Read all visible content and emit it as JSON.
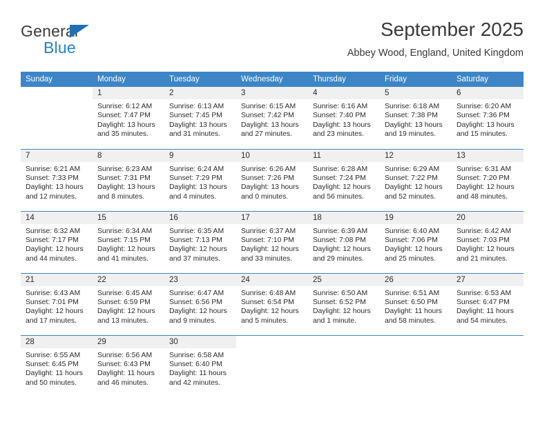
{
  "brand": {
    "name_top": "General",
    "name_bottom": "Blue",
    "accent_color": "#2083c9",
    "triangle_color": "#1f6fb5"
  },
  "header": {
    "title": "September 2025",
    "subtitle": "Abbey Wood, England, United Kingdom"
  },
  "theme": {
    "header_blue": "#3d85c6",
    "daynum_band": "#f0f0f0",
    "text": "#2b2b2b"
  },
  "weekday_headers": [
    "Sunday",
    "Monday",
    "Tuesday",
    "Wednesday",
    "Thursday",
    "Friday",
    "Saturday"
  ],
  "weeks": [
    [
      {
        "day": "",
        "sunrise": "",
        "sunset": "",
        "daylight": ""
      },
      {
        "day": "1",
        "sunrise": "Sunrise: 6:12 AM",
        "sunset": "Sunset: 7:47 PM",
        "daylight": "Daylight: 13 hours and 35 minutes."
      },
      {
        "day": "2",
        "sunrise": "Sunrise: 6:13 AM",
        "sunset": "Sunset: 7:45 PM",
        "daylight": "Daylight: 13 hours and 31 minutes."
      },
      {
        "day": "3",
        "sunrise": "Sunrise: 6:15 AM",
        "sunset": "Sunset: 7:42 PM",
        "daylight": "Daylight: 13 hours and 27 minutes."
      },
      {
        "day": "4",
        "sunrise": "Sunrise: 6:16 AM",
        "sunset": "Sunset: 7:40 PM",
        "daylight": "Daylight: 13 hours and 23 minutes."
      },
      {
        "day": "5",
        "sunrise": "Sunrise: 6:18 AM",
        "sunset": "Sunset: 7:38 PM",
        "daylight": "Daylight: 13 hours and 19 minutes."
      },
      {
        "day": "6",
        "sunrise": "Sunrise: 6:20 AM",
        "sunset": "Sunset: 7:36 PM",
        "daylight": "Daylight: 13 hours and 15 minutes."
      }
    ],
    [
      {
        "day": "7",
        "sunrise": "Sunrise: 6:21 AM",
        "sunset": "Sunset: 7:33 PM",
        "daylight": "Daylight: 13 hours and 12 minutes."
      },
      {
        "day": "8",
        "sunrise": "Sunrise: 6:23 AM",
        "sunset": "Sunset: 7:31 PM",
        "daylight": "Daylight: 13 hours and 8 minutes."
      },
      {
        "day": "9",
        "sunrise": "Sunrise: 6:24 AM",
        "sunset": "Sunset: 7:29 PM",
        "daylight": "Daylight: 13 hours and 4 minutes."
      },
      {
        "day": "10",
        "sunrise": "Sunrise: 6:26 AM",
        "sunset": "Sunset: 7:26 PM",
        "daylight": "Daylight: 13 hours and 0 minutes."
      },
      {
        "day": "11",
        "sunrise": "Sunrise: 6:28 AM",
        "sunset": "Sunset: 7:24 PM",
        "daylight": "Daylight: 12 hours and 56 minutes."
      },
      {
        "day": "12",
        "sunrise": "Sunrise: 6:29 AM",
        "sunset": "Sunset: 7:22 PM",
        "daylight": "Daylight: 12 hours and 52 minutes."
      },
      {
        "day": "13",
        "sunrise": "Sunrise: 6:31 AM",
        "sunset": "Sunset: 7:20 PM",
        "daylight": "Daylight: 12 hours and 48 minutes."
      }
    ],
    [
      {
        "day": "14",
        "sunrise": "Sunrise: 6:32 AM",
        "sunset": "Sunset: 7:17 PM",
        "daylight": "Daylight: 12 hours and 44 minutes."
      },
      {
        "day": "15",
        "sunrise": "Sunrise: 6:34 AM",
        "sunset": "Sunset: 7:15 PM",
        "daylight": "Daylight: 12 hours and 41 minutes."
      },
      {
        "day": "16",
        "sunrise": "Sunrise: 6:35 AM",
        "sunset": "Sunset: 7:13 PM",
        "daylight": "Daylight: 12 hours and 37 minutes."
      },
      {
        "day": "17",
        "sunrise": "Sunrise: 6:37 AM",
        "sunset": "Sunset: 7:10 PM",
        "daylight": "Daylight: 12 hours and 33 minutes."
      },
      {
        "day": "18",
        "sunrise": "Sunrise: 6:39 AM",
        "sunset": "Sunset: 7:08 PM",
        "daylight": "Daylight: 12 hours and 29 minutes."
      },
      {
        "day": "19",
        "sunrise": "Sunrise: 6:40 AM",
        "sunset": "Sunset: 7:06 PM",
        "daylight": "Daylight: 12 hours and 25 minutes."
      },
      {
        "day": "20",
        "sunrise": "Sunrise: 6:42 AM",
        "sunset": "Sunset: 7:03 PM",
        "daylight": "Daylight: 12 hours and 21 minutes."
      }
    ],
    [
      {
        "day": "21",
        "sunrise": "Sunrise: 6:43 AM",
        "sunset": "Sunset: 7:01 PM",
        "daylight": "Daylight: 12 hours and 17 minutes."
      },
      {
        "day": "22",
        "sunrise": "Sunrise: 6:45 AM",
        "sunset": "Sunset: 6:59 PM",
        "daylight": "Daylight: 12 hours and 13 minutes."
      },
      {
        "day": "23",
        "sunrise": "Sunrise: 6:47 AM",
        "sunset": "Sunset: 6:56 PM",
        "daylight": "Daylight: 12 hours and 9 minutes."
      },
      {
        "day": "24",
        "sunrise": "Sunrise: 6:48 AM",
        "sunset": "Sunset: 6:54 PM",
        "daylight": "Daylight: 12 hours and 5 minutes."
      },
      {
        "day": "25",
        "sunrise": "Sunrise: 6:50 AM",
        "sunset": "Sunset: 6:52 PM",
        "daylight": "Daylight: 12 hours and 1 minute."
      },
      {
        "day": "26",
        "sunrise": "Sunrise: 6:51 AM",
        "sunset": "Sunset: 6:50 PM",
        "daylight": "Daylight: 11 hours and 58 minutes."
      },
      {
        "day": "27",
        "sunrise": "Sunrise: 6:53 AM",
        "sunset": "Sunset: 6:47 PM",
        "daylight": "Daylight: 11 hours and 54 minutes."
      }
    ],
    [
      {
        "day": "28",
        "sunrise": "Sunrise: 6:55 AM",
        "sunset": "Sunset: 6:45 PM",
        "daylight": "Daylight: 11 hours and 50 minutes."
      },
      {
        "day": "29",
        "sunrise": "Sunrise: 6:56 AM",
        "sunset": "Sunset: 6:43 PM",
        "daylight": "Daylight: 11 hours and 46 minutes."
      },
      {
        "day": "30",
        "sunrise": "Sunrise: 6:58 AM",
        "sunset": "Sunset: 6:40 PM",
        "daylight": "Daylight: 11 hours and 42 minutes."
      },
      {
        "day": "",
        "sunrise": "",
        "sunset": "",
        "daylight": ""
      },
      {
        "day": "",
        "sunrise": "",
        "sunset": "",
        "daylight": ""
      },
      {
        "day": "",
        "sunrise": "",
        "sunset": "",
        "daylight": ""
      },
      {
        "day": "",
        "sunrise": "",
        "sunset": "",
        "daylight": ""
      }
    ]
  ]
}
